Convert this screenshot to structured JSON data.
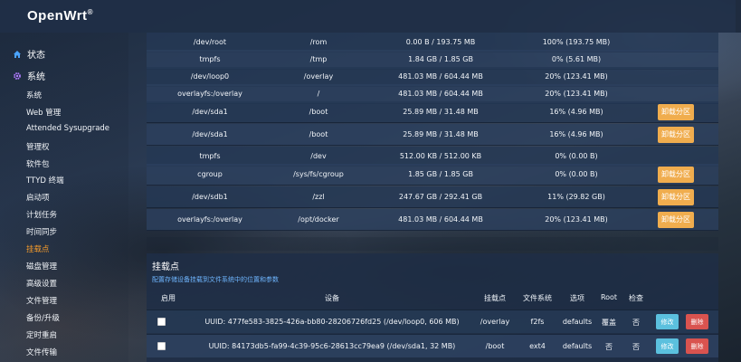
{
  "brand": {
    "name": "OpenWrt",
    "mark": "®"
  },
  "sidebar": {
    "status": {
      "label": "状态",
      "icon": "home-icon"
    },
    "system": {
      "label": "系统",
      "icon": "gear-icon"
    },
    "items": [
      {
        "label": "系统"
      },
      {
        "label": "Web 管理"
      },
      {
        "label": "Attended Sysupgrade"
      },
      {
        "label": "管理权"
      },
      {
        "label": "软件包"
      },
      {
        "label": "TTYD 终端"
      },
      {
        "label": "启动项"
      },
      {
        "label": "计划任务"
      },
      {
        "label": "时间同步"
      },
      {
        "label": "挂载点"
      },
      {
        "label": "磁盘管理"
      },
      {
        "label": "高级设置"
      },
      {
        "label": "文件管理"
      },
      {
        "label": "备份/升级"
      },
      {
        "label": "定时重启"
      },
      {
        "label": "文件传输"
      }
    ],
    "active_index": 9,
    "active_color": "#f39a2b"
  },
  "mounted": {
    "unmount_label": "卸载分区",
    "rows": [
      {
        "fs": "/dev/root",
        "mount": "/rom",
        "used": "0.00 B / 193.75 MB",
        "pct": "100% (193.75 MB)",
        "unmount": false
      },
      {
        "fs": "tmpfs",
        "mount": "/tmp",
        "used": "1.84 GB / 1.85 GB",
        "pct": "0% (5.61 MB)",
        "unmount": false
      },
      {
        "fs": "/dev/loop0",
        "mount": "/overlay",
        "used": "481.03 MB / 604.44 MB",
        "pct": "20% (123.41 MB)",
        "unmount": false
      },
      {
        "fs": "overlayfs:/overlay",
        "mount": "/",
        "used": "481.03 MB / 604.44 MB",
        "pct": "20% (123.41 MB)",
        "unmount": false
      },
      {
        "fs": "/dev/sda1",
        "mount": "/boot",
        "used": "25.89 MB / 31.48 MB",
        "pct": "16% (4.96 MB)",
        "unmount": true
      },
      {
        "fs": "/dev/sda1",
        "mount": "/boot",
        "used": "25.89 MB / 31.48 MB",
        "pct": "16% (4.96 MB)",
        "unmount": true
      },
      {
        "fs": "tmpfs",
        "mount": "/dev",
        "used": "512.00 KB / 512.00 KB",
        "pct": "0% (0.00 B)",
        "unmount": false
      },
      {
        "fs": "cgroup",
        "mount": "/sys/fs/cgroup",
        "used": "1.85 GB / 1.85 GB",
        "pct": "0% (0.00 B)",
        "unmount": true
      },
      {
        "fs": "/dev/sdb1",
        "mount": "/zzl",
        "used": "247.67 GB / 292.41 GB",
        "pct": "11% (29.82 GB)",
        "unmount": true
      },
      {
        "fs": "overlayfs:/overlay",
        "mount": "/opt/docker",
        "used": "481.03 MB / 604.44 MB",
        "pct": "20% (123.41 MB)",
        "unmount": true
      }
    ]
  },
  "mount_section": {
    "title": "挂载点",
    "description": "配置存储设备挂载到文件系统中的位置和参数",
    "headers": {
      "enabled": "启用",
      "device": "设备",
      "mountpoint": "挂载点",
      "fs": "文件系统",
      "options": "选项",
      "root": "Root",
      "check": "检查"
    },
    "edit_label": "修改",
    "delete_label": "删除",
    "rows": [
      {
        "device": "UUID: 477fe583-3825-426a-bb80-28206726fd25 (/dev/loop0, 606 MB)",
        "mountpoint": "/overlay",
        "fs": "f2fs",
        "options": "defaults",
        "root": "覆盖",
        "check": "否"
      },
      {
        "device": "UUID: 84173db5-fa99-4c39-95c6-28613cc79ea9 (/dev/sda1, 32 MB)",
        "mountpoint": "/boot",
        "fs": "ext4",
        "options": "defaults",
        "root": "否",
        "check": "否"
      }
    ]
  }
}
